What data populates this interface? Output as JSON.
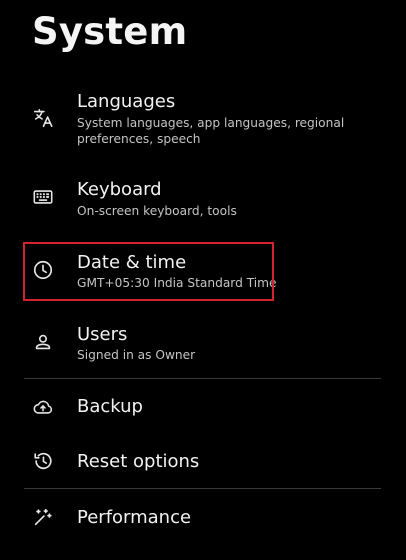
{
  "page": {
    "title": "System",
    "highlight_color": "#d3232f"
  },
  "items": [
    {
      "title": "Languages",
      "subtitle_line1": "System languages, app languages, regional",
      "subtitle_line2": "preferences, speech",
      "icon": "translate-icon"
    },
    {
      "title": "Keyboard",
      "subtitle_line1": "On-screen keyboard, tools",
      "icon": "keyboard-icon"
    },
    {
      "title": "Date & time",
      "subtitle_line1": "GMT+05:30 India Standard Time",
      "icon": "clock-icon",
      "highlighted": true
    },
    {
      "title": "Users",
      "subtitle_line1": "Signed in as Owner",
      "icon": "person-icon"
    },
    {
      "title": "Backup",
      "icon": "cloud-upload-icon"
    },
    {
      "title": "Reset options",
      "icon": "history-icon"
    },
    {
      "title": "Performance",
      "icon": "performance-wand-icon"
    }
  ]
}
